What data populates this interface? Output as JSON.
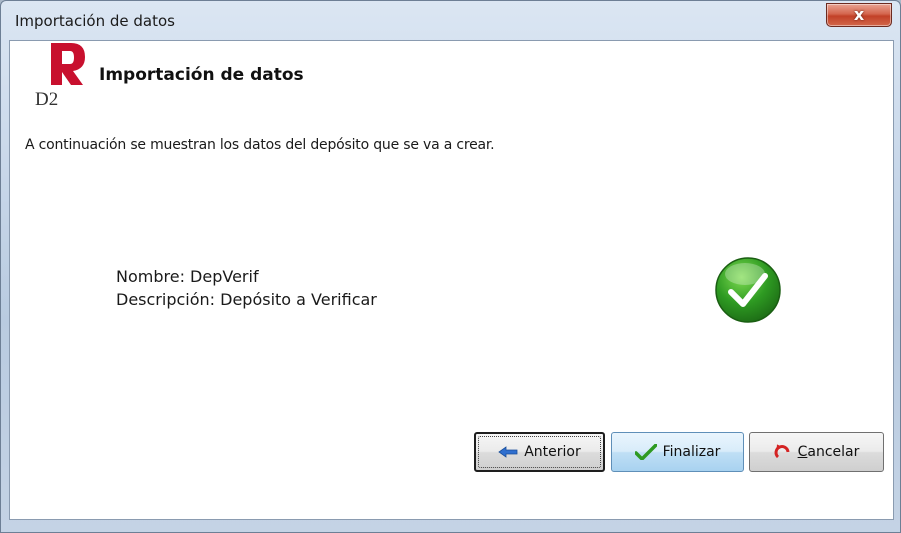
{
  "window": {
    "title": "Importación de datos",
    "close_glyph": "x"
  },
  "header": {
    "logo_text": "D2",
    "title": "Importación de datos"
  },
  "intro_text": "A continuación se muestran los datos del depósito que se va a crear.",
  "deposit": {
    "name_line": "Nombre: DepVerif",
    "description_line": "Descripción: Depósito a Verificar"
  },
  "status_icon": "check-circle-icon",
  "buttons": {
    "back_label": "Anterior",
    "finish_label": "Finalizar",
    "cancel_first_letter": "C",
    "cancel_rest": "ancelar"
  },
  "colors": {
    "logo_red": "#c8102e",
    "check_green": "#2e9a22",
    "back_arrow_blue": "#2f6fcf",
    "cancel_red": "#d42323"
  }
}
